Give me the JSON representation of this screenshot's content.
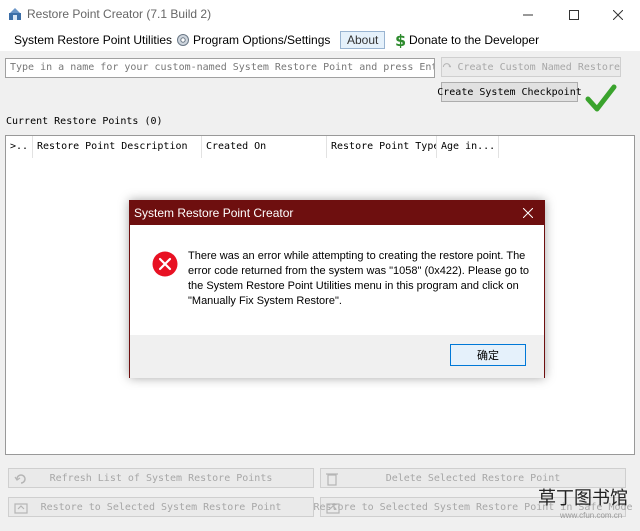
{
  "window": {
    "title": "Restore Point Creator (7.1 Build 2)"
  },
  "menu": {
    "utilities": "System Restore Point Utilities",
    "options": "Program Options/Settings",
    "about": "About",
    "donate": "Donate to the Developer"
  },
  "toolbar": {
    "name_placeholder": "Type in a name for your custom-named System Restore Point and press Enter...",
    "create_named_label": "Create Custom Named Restore",
    "create_checkpoint_label": "Create System Checkpoint"
  },
  "restore_points": {
    "section_label": "Current Restore Points (0)",
    "columns": [
      ">..",
      "Restore Point Description",
      "Created On",
      "Restore Point Type",
      "Age in..."
    ]
  },
  "dialog": {
    "title": "System Restore Point Creator",
    "message": "There was an error while attempting to creating the restore point. The error code returned from the system was \"1058\" (0x422). Please go to the System Restore Point Utilities menu in this program and click on \"Manually Fix System Restore\".",
    "ok_label": "确定"
  },
  "actions": {
    "refresh_label": "Refresh List of System Restore Points",
    "delete_label": "Delete Selected Restore Point",
    "restore_label": "Restore to Selected System Restore Point",
    "restore_safe_label": "Restore to Selected System Restore Point in Safe Mode"
  },
  "watermark": {
    "brand": "草丁图书馆",
    "site": "www.cfun.com.cn"
  },
  "colors": {
    "dialog_title": "#6e0f0f",
    "error_red": "#e81123",
    "check_green": "#3aa32d",
    "donate_green": "#2e8b2e",
    "accent": "#0078d7"
  }
}
